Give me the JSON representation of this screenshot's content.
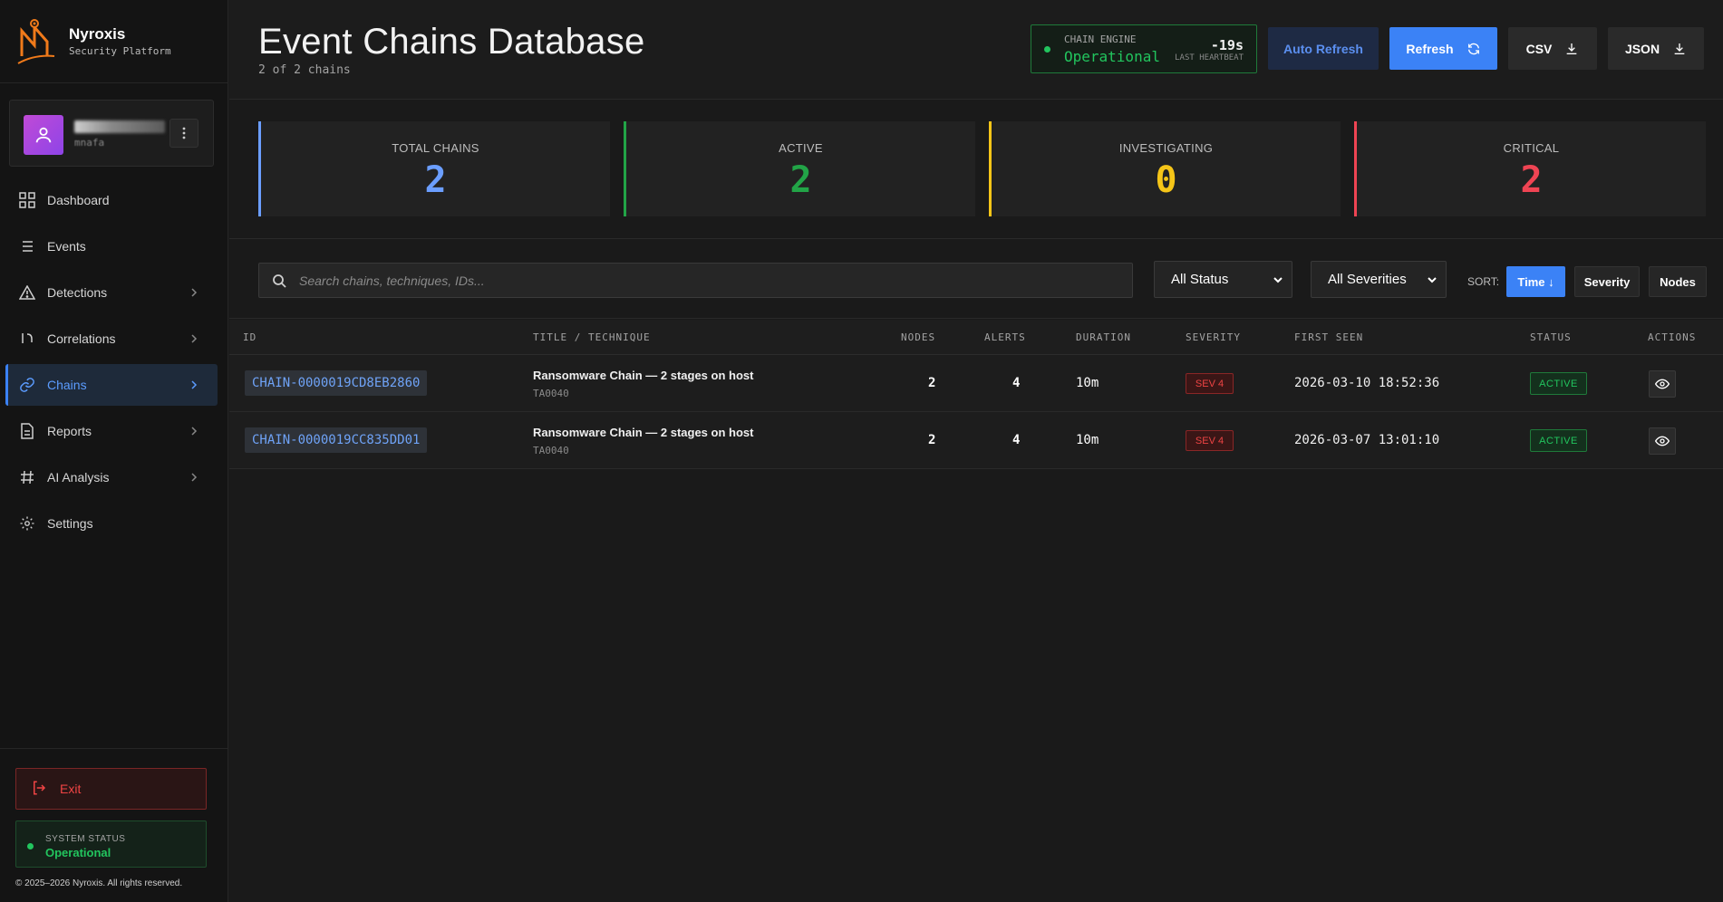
{
  "brand": {
    "name": "Nyroxis",
    "subtitle": "Security Platform"
  },
  "user": {
    "sub": "mnafa"
  },
  "nav": [
    {
      "label": "Dashboard",
      "icon": "grid-icon"
    },
    {
      "label": "Events",
      "icon": "list-icon"
    },
    {
      "label": "Detections",
      "icon": "warning-icon"
    },
    {
      "label": "Correlations",
      "icon": "correlation-icon"
    },
    {
      "label": "Chains",
      "icon": "link-icon"
    },
    {
      "label": "Reports",
      "icon": "document-icon"
    },
    {
      "label": "AI Analysis",
      "icon": "hash-icon"
    },
    {
      "label": "Settings",
      "icon": "gear-icon"
    }
  ],
  "sidebar": {
    "exit_label": "Exit",
    "system_status_label": "SYSTEM STATUS",
    "system_status_value": "Operational",
    "copyright": "© 2025–2026 Nyroxis. All rights reserved."
  },
  "header": {
    "title": "Event Chains Database",
    "subtitle": "2 of 2 chains",
    "engine_label": "CHAIN ENGINE",
    "engine_status": "Operational",
    "engine_time": "-19s",
    "engine_heartbeat_label": "LAST HEARTBEAT",
    "auto_refresh_label": "Auto Refresh",
    "refresh_label": "Refresh",
    "csv_label": "CSV",
    "json_label": "JSON"
  },
  "stats": [
    {
      "label": "TOTAL CHAINS",
      "value": "2",
      "color": "#6b9eff"
    },
    {
      "label": "ACTIVE",
      "value": "2",
      "color": "#22a447"
    },
    {
      "label": "INVESTIGATING",
      "value": "0",
      "color": "#f5c518"
    },
    {
      "label": "CRITICAL",
      "value": "2",
      "color": "#ef4453"
    }
  ],
  "filters": {
    "search_placeholder": "Search chains, techniques, IDs...",
    "status_selected": "All Status",
    "severity_selected": "All Severities",
    "sort_label": "SORT:",
    "sort_time": "Time ↓",
    "sort_severity": "Severity",
    "sort_nodes": "Nodes"
  },
  "table": {
    "columns": {
      "id": "ID",
      "title": "TITLE / TECHNIQUE",
      "nodes": "NODES",
      "alerts": "ALERTS",
      "duration": "DURATION",
      "severity": "SEVERITY",
      "first_seen": "FIRST SEEN",
      "status": "STATUS",
      "actions": "ACTIONS"
    },
    "rows": [
      {
        "id": "CHAIN-0000019CD8EB2860",
        "title": "Ransomware Chain — 2 stages on host",
        "technique": "TA0040",
        "nodes": "2",
        "alerts": "4",
        "duration": "10m",
        "severity": "SEV 4",
        "first_seen": "2026-03-10 18:52:36",
        "status": "ACTIVE"
      },
      {
        "id": "CHAIN-0000019CC835DD01",
        "title": "Ransomware Chain — 2 stages on host",
        "technique": "TA0040",
        "nodes": "2",
        "alerts": "4",
        "duration": "10m",
        "severity": "SEV 4",
        "first_seen": "2026-03-07 13:01:10",
        "status": "ACTIVE"
      }
    ]
  }
}
